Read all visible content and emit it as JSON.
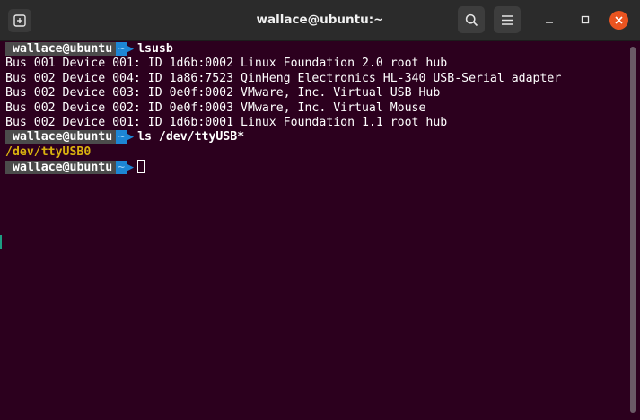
{
  "window": {
    "title": "wallace@ubuntu:~",
    "icons": {
      "new_tab": "new-tab-icon",
      "search": "search-icon",
      "menu": "hamburger-menu-icon",
      "minimize": "minimize-icon",
      "maximize": "maximize-icon",
      "close": "close-icon"
    },
    "colors": {
      "background": "#2c001e",
      "titlebar": "#2b2b2b",
      "close": "#e95420",
      "prompt_user_bg": "#4b4b4b",
      "prompt_dir_bg": "#1d86d4",
      "dir_output": "#d9b20f"
    }
  },
  "terminal": {
    "prompt": {
      "user": "wallace@ubuntu",
      "dir": "~"
    },
    "lines": [
      {
        "type": "prompt",
        "cmd": "lsusb"
      },
      {
        "type": "out",
        "text": "Bus 001 Device 001: ID 1d6b:0002 Linux Foundation 2.0 root hub"
      },
      {
        "type": "out",
        "text": "Bus 002 Device 004: ID 1a86:7523 QinHeng Electronics HL-340 USB-Serial adapter"
      },
      {
        "type": "out",
        "text": "Bus 002 Device 003: ID 0e0f:0002 VMware, Inc. Virtual USB Hub"
      },
      {
        "type": "out",
        "text": "Bus 002 Device 002: ID 0e0f:0003 VMware, Inc. Virtual Mouse"
      },
      {
        "type": "out",
        "text": "Bus 002 Device 001: ID 1d6b:0001 Linux Foundation 1.1 root hub"
      },
      {
        "type": "prompt",
        "cmd": "ls /dev/ttyUSB*"
      },
      {
        "type": "dir",
        "text": "/dev/ttyUSB0"
      },
      {
        "type": "prompt",
        "cmd": ""
      }
    ]
  }
}
